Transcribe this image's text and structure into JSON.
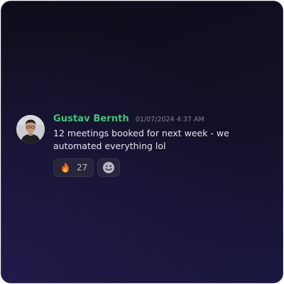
{
  "message": {
    "author": "Gustav Bernth",
    "timestamp": "01/07/2024 4:37 AM",
    "text": "12 meetings booked for next week - we automated everything lol",
    "author_color": "#43c07a"
  },
  "reactions": [
    {
      "icon": "fire-emoji-icon",
      "count": "27"
    }
  ],
  "add_reaction": {
    "icon": "smiley-face-icon"
  }
}
